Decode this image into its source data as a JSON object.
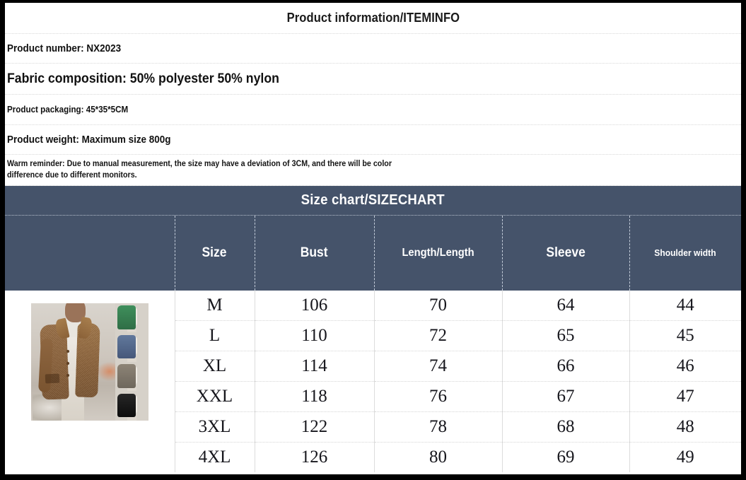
{
  "info": {
    "title": "Product information/ITEMINFO",
    "rows": [
      {
        "text": "Product number: NX2023"
      },
      {
        "text": "Fabric composition: 50% polyester 50% nylon"
      },
      {
        "text": "Product packaging: 45*35*5CM"
      },
      {
        "text": "Product weight: Maximum size 800g"
      },
      {
        "text": "Warm reminder: Due to manual measurement, the size may have a deviation of 3CM, and there will be color difference due to different monitors."
      }
    ]
  },
  "size_chart": {
    "title": "Size chart/SIZECHART",
    "header_color": "#45536a",
    "header_text_color": "#ffffff",
    "columns": [
      {
        "label": ""
      },
      {
        "label": "Size"
      },
      {
        "label": "Bust"
      },
      {
        "label": "Length/Length"
      },
      {
        "label": "Sleeve"
      },
      {
        "label": "Shoulder width"
      }
    ],
    "rows": [
      {
        "size": "M",
        "bust": "106",
        "length": "70",
        "sleeve": "64",
        "shoulder": "44"
      },
      {
        "size": "L",
        "bust": "110",
        "length": "72",
        "sleeve": "65",
        "shoulder": "45"
      },
      {
        "size": "XL",
        "bust": "114",
        "length": "74",
        "sleeve": "66",
        "shoulder": "46"
      },
      {
        "size": "XXL",
        "bust": "118",
        "length": "76",
        "sleeve": "67",
        "shoulder": "47"
      },
      {
        "size": "3XL",
        "bust": "122",
        "length": "78",
        "sleeve": "68",
        "shoulder": "48"
      },
      {
        "size": "4XL",
        "bust": "126",
        "length": "80",
        "sleeve": "69",
        "shoulder": "49"
      }
    ]
  },
  "product_photo": {
    "description": "Man wearing brown fleece jacket over white turtleneck and light trousers",
    "variant_colors": [
      "#3f8f5c",
      "#61789c",
      "#8d8477",
      "#262626"
    ]
  }
}
